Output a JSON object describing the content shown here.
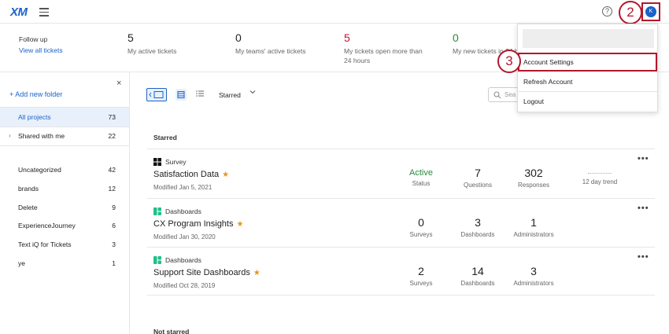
{
  "app": {
    "logo": "XM"
  },
  "header": {
    "help_icon": "?",
    "avatar_initial": "K"
  },
  "steps": [
    "2",
    "3"
  ],
  "stats": {
    "followup_label": "Follow up",
    "followup_link": "View all tickets",
    "items": [
      {
        "value": "5",
        "label": "My active tickets",
        "color": "#222222"
      },
      {
        "value": "0",
        "label": "My teams' active tickets",
        "color": "#222222"
      },
      {
        "value": "5",
        "label": "My tickets open more than 24 hours",
        "color": "#c8102e"
      },
      {
        "value": "0",
        "label": "My new tickets in 24 ho",
        "color": "#2b8a3e"
      }
    ]
  },
  "sidebar": {
    "close_icon": "×",
    "add_folder": "+ Add new folder",
    "items": [
      {
        "label": "All projects",
        "count": "73"
      },
      {
        "label": "Shared with me",
        "count": "22"
      },
      {
        "label": "Uncategorized",
        "count": "42"
      },
      {
        "label": "brands",
        "count": "12"
      },
      {
        "label": "Delete",
        "count": "9"
      },
      {
        "label": "ExperienceJourney",
        "count": "6"
      },
      {
        "label": "Text iQ for Tickets",
        "count": "3"
      },
      {
        "label": "ye",
        "count": "1"
      }
    ]
  },
  "toolbar": {
    "filter_label": "Starred",
    "search_placeholder": "Sea"
  },
  "sections": {
    "starred": "Starred",
    "not_starred": "Not starred"
  },
  "projects": [
    {
      "type": "Survey",
      "name": "Satisfaction Data",
      "modified": "Modified Jan 5, 2021",
      "metrics": [
        {
          "value": "Active",
          "label": "Status"
        },
        {
          "value": "7",
          "label": "Questions"
        },
        {
          "value": "302",
          "label": "Responses"
        }
      ],
      "trend_label": "12 day trend"
    },
    {
      "type": "Dashboards",
      "name": "CX Program Insights",
      "modified": "Modified Jan 30, 2020",
      "metrics": [
        {
          "value": "0",
          "label": "Surveys"
        },
        {
          "value": "3",
          "label": "Dashboards"
        },
        {
          "value": "1",
          "label": "Administrators"
        }
      ]
    },
    {
      "type": "Dashboards",
      "name": "Support Site Dashboards",
      "modified": "Modified Oct 28, 2019",
      "metrics": [
        {
          "value": "2",
          "label": "Surveys"
        },
        {
          "value": "14",
          "label": "Dashboards"
        },
        {
          "value": "3",
          "label": "Administrators"
        }
      ]
    }
  ],
  "dropdown": {
    "items": [
      "Account Settings",
      "Refresh Account",
      "Logout"
    ]
  },
  "colors": {
    "accent": "#1a63c9",
    "highlight": "#b3172b",
    "star": "#e8951a"
  }
}
